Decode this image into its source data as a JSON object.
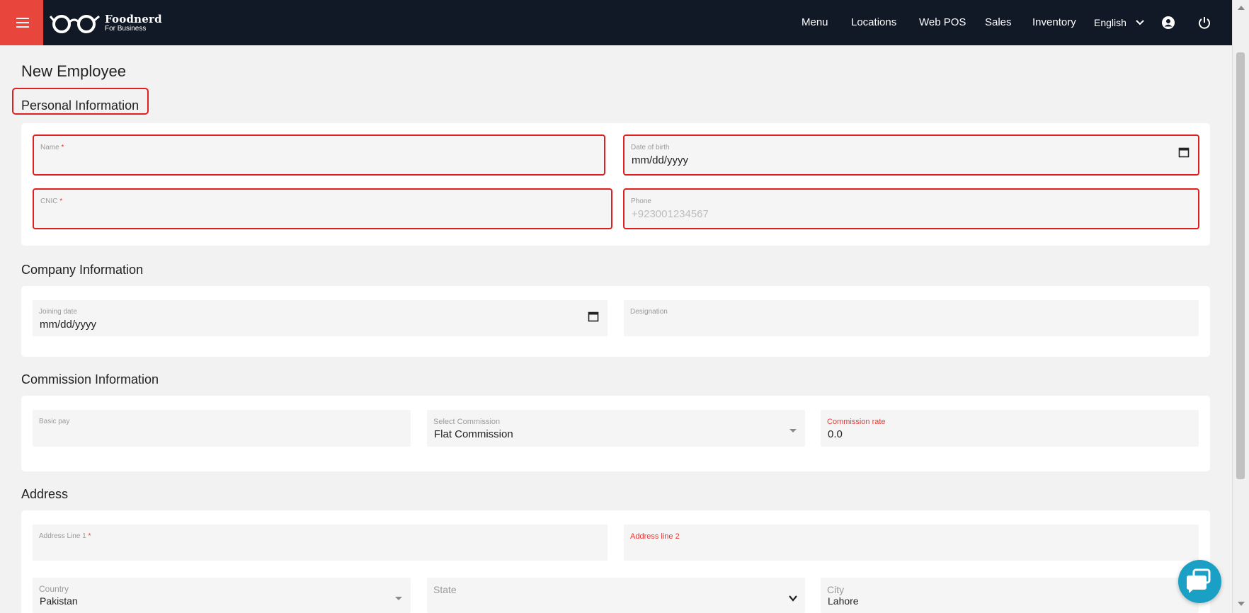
{
  "header": {
    "brand_name": "Foodnerd",
    "brand_sub": "For Business",
    "nav": [
      "Menu",
      "Locations",
      "Web POS",
      "Sales",
      "Inventory"
    ],
    "language": "English"
  },
  "page": {
    "title": "New Employee"
  },
  "personal": {
    "title": "Personal Information",
    "name_label": "Name",
    "dob_label": "Date of birth",
    "dob_value": "mm/dd/yyyy",
    "cnic_label": "CNIC",
    "phone_label": "Phone",
    "phone_placeholder": "+923001234567",
    "required_mark": "*"
  },
  "company": {
    "title": "Company Information",
    "joining_label": "Joining date",
    "joining_value": "mm/dd/yyyy",
    "designation_label": "Designation"
  },
  "commission": {
    "title": "Commission Information",
    "basic_pay_label": "Basic pay",
    "select_label": "Select Commission",
    "select_value": "Flat Commission",
    "rate_label": "Commission rate",
    "rate_value": "0.0"
  },
  "address": {
    "title": "Address",
    "line1_label": "Address Line 1",
    "line2_label": "Address line 2",
    "country_label": "Country",
    "country_value": "Pakistan",
    "state_label": "State",
    "city_label": "City",
    "city_value": "Lahore",
    "required_mark": "*"
  },
  "colors": {
    "header_bg": "#111826",
    "accent": "#e8453c",
    "highlight": "#e02020",
    "chat": "#1aa0c4"
  },
  "icons": [
    "hamburger-icon",
    "glasses-logo-icon",
    "chevron-down-icon",
    "account-circle-icon",
    "power-icon",
    "calendar-icon",
    "dropdown-arrow-icon",
    "chat-bubble-icon"
  ]
}
